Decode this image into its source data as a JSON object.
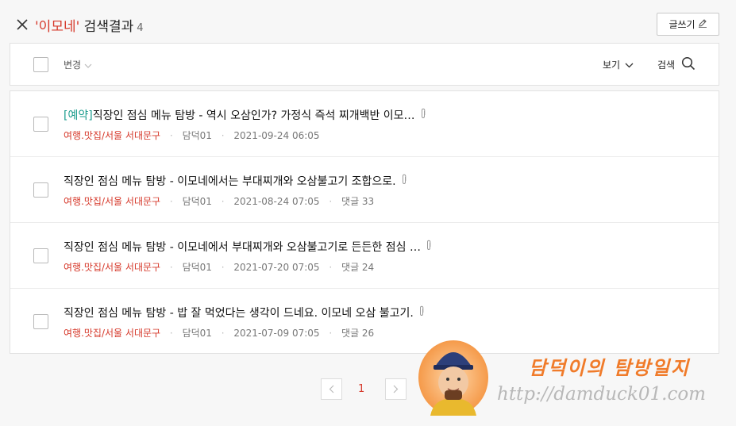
{
  "header": {
    "keyword": "'이모네'",
    "suffix": " 검색결과",
    "count": "4",
    "write_label": "글쓰기"
  },
  "toolbar": {
    "change_label": "변경",
    "view_label": "보기",
    "search_label": "검색"
  },
  "posts": [
    {
      "tag": "[예약]",
      "title": "직장인 점심 메뉴 탐방 - 역시 오삼인가? 가정식 즉석 찌개백반 이모…",
      "category": "여행.맛집/서울 서대문구",
      "author": "담덕01",
      "date": "2021-09-24 06:05",
      "comments": ""
    },
    {
      "tag": "",
      "title": "직장인 점심 메뉴 탐방 - 이모네에서는 부대찌개와 오삼불고기 조합으로.",
      "category": "여행.맛집/서울 서대문구",
      "author": "담덕01",
      "date": "2021-08-24 07:05",
      "comments": "댓글 33"
    },
    {
      "tag": "",
      "title": "직장인 점심 메뉴 탐방 - 이모네에서 부대찌개와 오삼불고기로 든든한 점심 …",
      "category": "여행.맛집/서울 서대문구",
      "author": "담덕01",
      "date": "2021-07-20 07:05",
      "comments": "댓글 24"
    },
    {
      "tag": "",
      "title": "직장인 점심 메뉴 탐방 - 밥 잘 먹었다는 생각이 드네요. 이모네 오삼 불고기.",
      "category": "여행.맛집/서울 서대문구",
      "author": "담덕01",
      "date": "2021-07-09 07:05",
      "comments": "댓글 26"
    }
  ],
  "pagination": {
    "current": "1"
  },
  "watermark": {
    "title": "담덕이의 탐방일지",
    "url": "http://damduck01.com"
  },
  "colors": {
    "accent": "#d6392b",
    "tag": "#1a9c8d",
    "watermark_orange": "#f07b2a"
  }
}
